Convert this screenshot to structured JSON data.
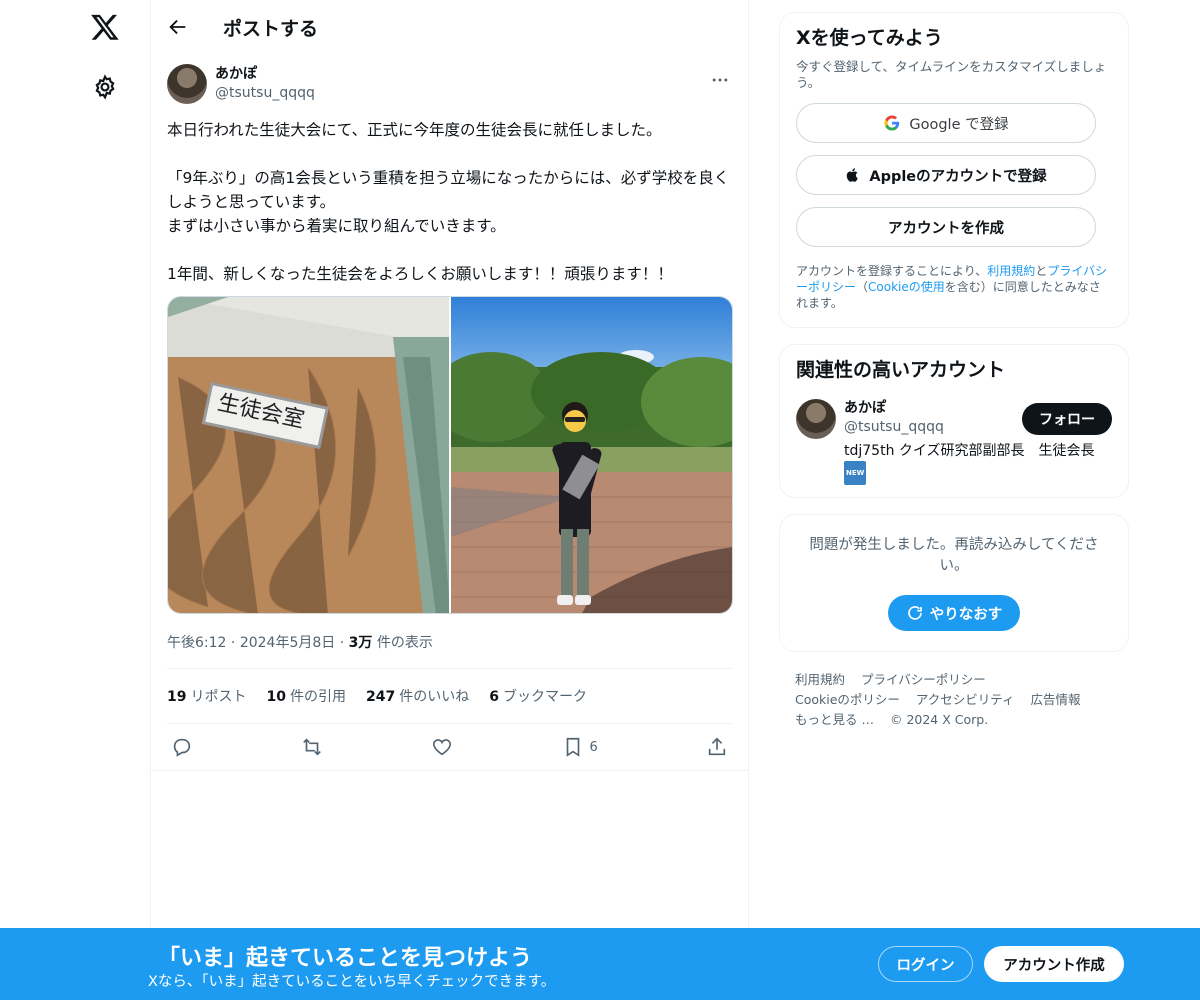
{
  "header": {
    "title": "ポストする"
  },
  "post": {
    "author_name": "あかぽ",
    "author_handle": "@tsutsu_qqqq",
    "text": "本日行われた生徒大会にて、正式に今年度の生徒会長に就任しました。\n\n「9年ぶり」の高1会長という重積を担う立場になったからには、必ず学校を良くしようと思っています。\nまずは小さい事から着実に取り組んでいきます。\n\n1年間、新しくなった生徒会をよろしくお願いします！！頑張ります！！",
    "image_left_sign": "生徒会室",
    "time": "午後6:12",
    "date": "2024年5月8日",
    "views_count": "3万",
    "views_label": "件の表示",
    "stats": [
      {
        "count": "19",
        "label": "リポスト"
      },
      {
        "count": "10",
        "label": "件の引用"
      },
      {
        "count": "247",
        "label": "件のいいね"
      },
      {
        "count": "6",
        "label": "ブックマーク"
      }
    ],
    "bookmark_count": "6"
  },
  "signup": {
    "title": "Xを使ってみよう",
    "subtitle": "今すぐ登録して、タイムラインをカスタマイズしましょう。",
    "google": "Google で登録",
    "apple": "Appleのアカウントで登録",
    "create": "アカウントを作成",
    "terms_pre": "アカウントを登録することにより、",
    "terms_link1": "利用規約",
    "terms_and": "と",
    "terms_link2": "プライバシーポリシー",
    "terms_paren_open": "（",
    "terms_link3": "Cookieの使用",
    "terms_post": "を含む）に同意したとみなされます。"
  },
  "related": {
    "title": "関連性の高いアカウント",
    "name": "あかぽ",
    "handle": "@tsutsu_qqqq",
    "bio": "tdj75th クイズ研究部副部長　生徒会長",
    "badge": "NEW",
    "follow": "フォロー"
  },
  "error": {
    "message": "問題が発生しました。再読み込みしてください。",
    "retry": "やりなおす"
  },
  "footer": {
    "links": [
      "利用規約",
      "プライバシーポリシー",
      "Cookieのポリシー",
      "アクセシビリティ",
      "広告情報",
      "もっと見る …"
    ],
    "copyright": "© 2024 X Corp."
  },
  "banner": {
    "title": "「いま」起きていることを見つけよう",
    "subtitle": "Xなら、「いま」起きていることをいち早くチェックできます。",
    "login": "ログイン",
    "signup": "アカウント作成"
  }
}
